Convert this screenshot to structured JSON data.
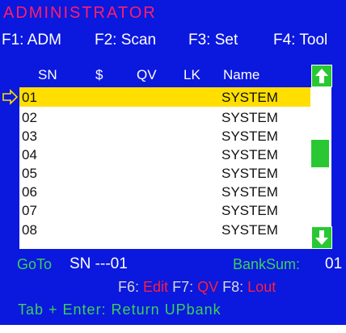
{
  "title": "ADMINISTRATOR",
  "function_keys": [
    {
      "label": "F1: ADM"
    },
    {
      "label": "F2: Scan"
    },
    {
      "label": "F3: Set"
    },
    {
      "label": "F4: Tool"
    }
  ],
  "columns": {
    "sn": "SN",
    "dollar": "$",
    "qv": "QV",
    "lk": "LK",
    "name": "Name"
  },
  "rows": [
    {
      "sn": "01",
      "name": "SYSTEM"
    },
    {
      "sn": "02",
      "name": "SYSTEM"
    },
    {
      "sn": "03",
      "name": "SYSTEM"
    },
    {
      "sn": "04",
      "name": "SYSTEM"
    },
    {
      "sn": "05",
      "name": "SYSTEM"
    },
    {
      "sn": "06",
      "name": "SYSTEM"
    },
    {
      "sn": "07",
      "name": "SYSTEM"
    },
    {
      "sn": "08",
      "name": "SYSTEM"
    }
  ],
  "selected_row": 0,
  "goto": {
    "label": "GoTo",
    "value": "SN ---01"
  },
  "bank_sum": {
    "label": "BankSum:",
    "value": "01"
  },
  "function_keys_2": {
    "f6": "F6:",
    "f6_action": "Edit",
    "f7": "F7:",
    "f7_action": "QV",
    "f8": "F8:",
    "f8_action": "Lout"
  },
  "help_line": "Tab + Enter: Return UPbank",
  "icons": {
    "pointer": "hollow-right-arrow-icon",
    "scroll_up": "arrow-up-icon",
    "scroll_down": "arrow-down-icon"
  },
  "colors": {
    "background": "#0b18de",
    "title": "#ff1e6c",
    "highlight": "#ffde00",
    "green": "#3bd15a",
    "red": "#ff1e3c"
  }
}
